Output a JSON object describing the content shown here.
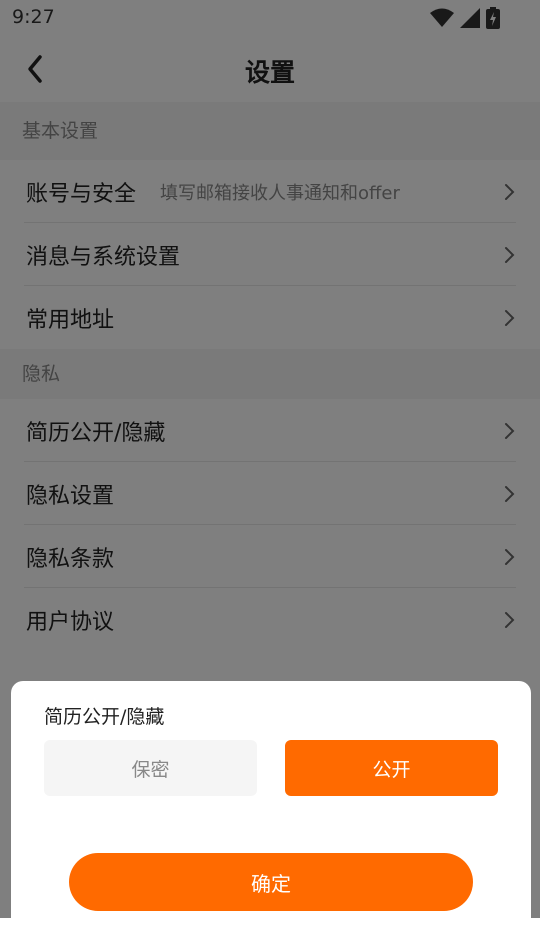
{
  "status_bar": {
    "time": "9:27"
  },
  "header": {
    "title": "设置"
  },
  "sections": [
    {
      "title": "基本设置",
      "items": [
        {
          "label": "账号与安全",
          "hint": "填写邮箱接收人事通知和offer"
        },
        {
          "label": "消息与系统设置",
          "hint": ""
        },
        {
          "label": "常用地址",
          "hint": ""
        }
      ]
    },
    {
      "title": "隐私",
      "items": [
        {
          "label": "简历公开/隐藏",
          "hint": ""
        },
        {
          "label": "隐私设置",
          "hint": ""
        },
        {
          "label": "隐私条款",
          "hint": ""
        },
        {
          "label": "用户协议",
          "hint": ""
        }
      ]
    }
  ],
  "sheet": {
    "title": "简历公开/隐藏",
    "options": [
      "保密",
      "公开"
    ],
    "selected": "公开",
    "confirm_label": "确定"
  },
  "colors": {
    "accent": "#ff6a00",
    "overlay": "rgba(0,0,0,0.5)"
  },
  "icons": [
    "wifi-icon",
    "signal-icon",
    "battery-icon",
    "back-arrow-icon",
    "chevron-right-icon"
  ]
}
